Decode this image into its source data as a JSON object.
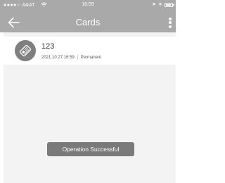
{
  "status_bar": {
    "signal_dots": "●●●●○",
    "carrier": "A&AT",
    "wifi_icon": "wifi-icon",
    "time": "16:59",
    "location_glyph": "➤",
    "bluetooth_glyph": "∗",
    "battery_icon": "battery-icon"
  },
  "header": {
    "title": "Cards",
    "back_icon": "arrow-left-icon",
    "menu_icon": "more-vertical-icon",
    "background_color": "#a9a9a9"
  },
  "cards": [
    {
      "name": "123",
      "timestamp": "2021.10.27 16:59",
      "validity": "Permanent",
      "icon": "key-card-icon"
    }
  ],
  "toast": {
    "message": "Operation Successful"
  }
}
